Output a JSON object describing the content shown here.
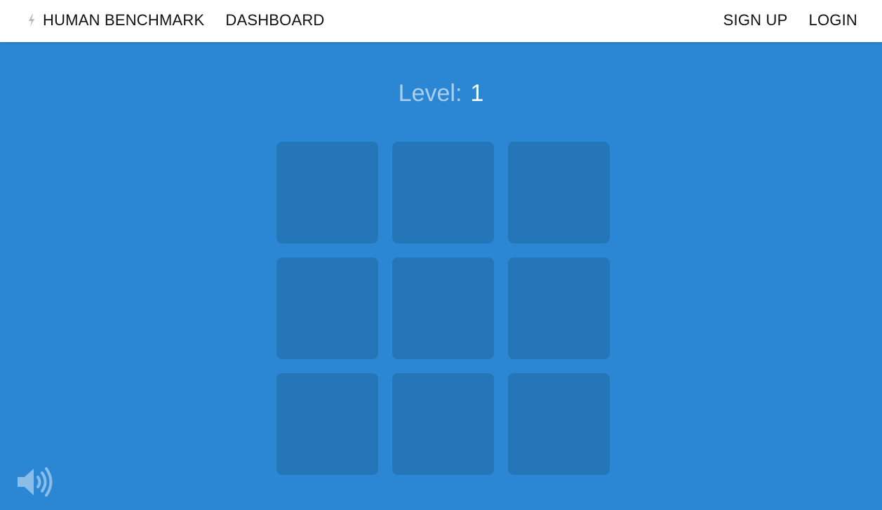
{
  "nav": {
    "brand_label": "HUMAN BENCHMARK",
    "dashboard_label": "DASHBOARD",
    "signup_label": "SIGN UP",
    "login_label": "LOGIN",
    "brand_icon": "bolt-icon"
  },
  "game": {
    "level_label": "Level:",
    "level_value": "1",
    "grid_rows": 3,
    "grid_cols": 3,
    "tiles": [
      "",
      "",
      "",
      "",
      "",
      "",
      "",
      "",
      ""
    ]
  },
  "controls": {
    "sound_icon": "speaker-volume-icon"
  },
  "colors": {
    "background": "#2b87d3",
    "tile": "#2674c4",
    "topbar": "#ffffff",
    "nav_text": "#111111"
  }
}
